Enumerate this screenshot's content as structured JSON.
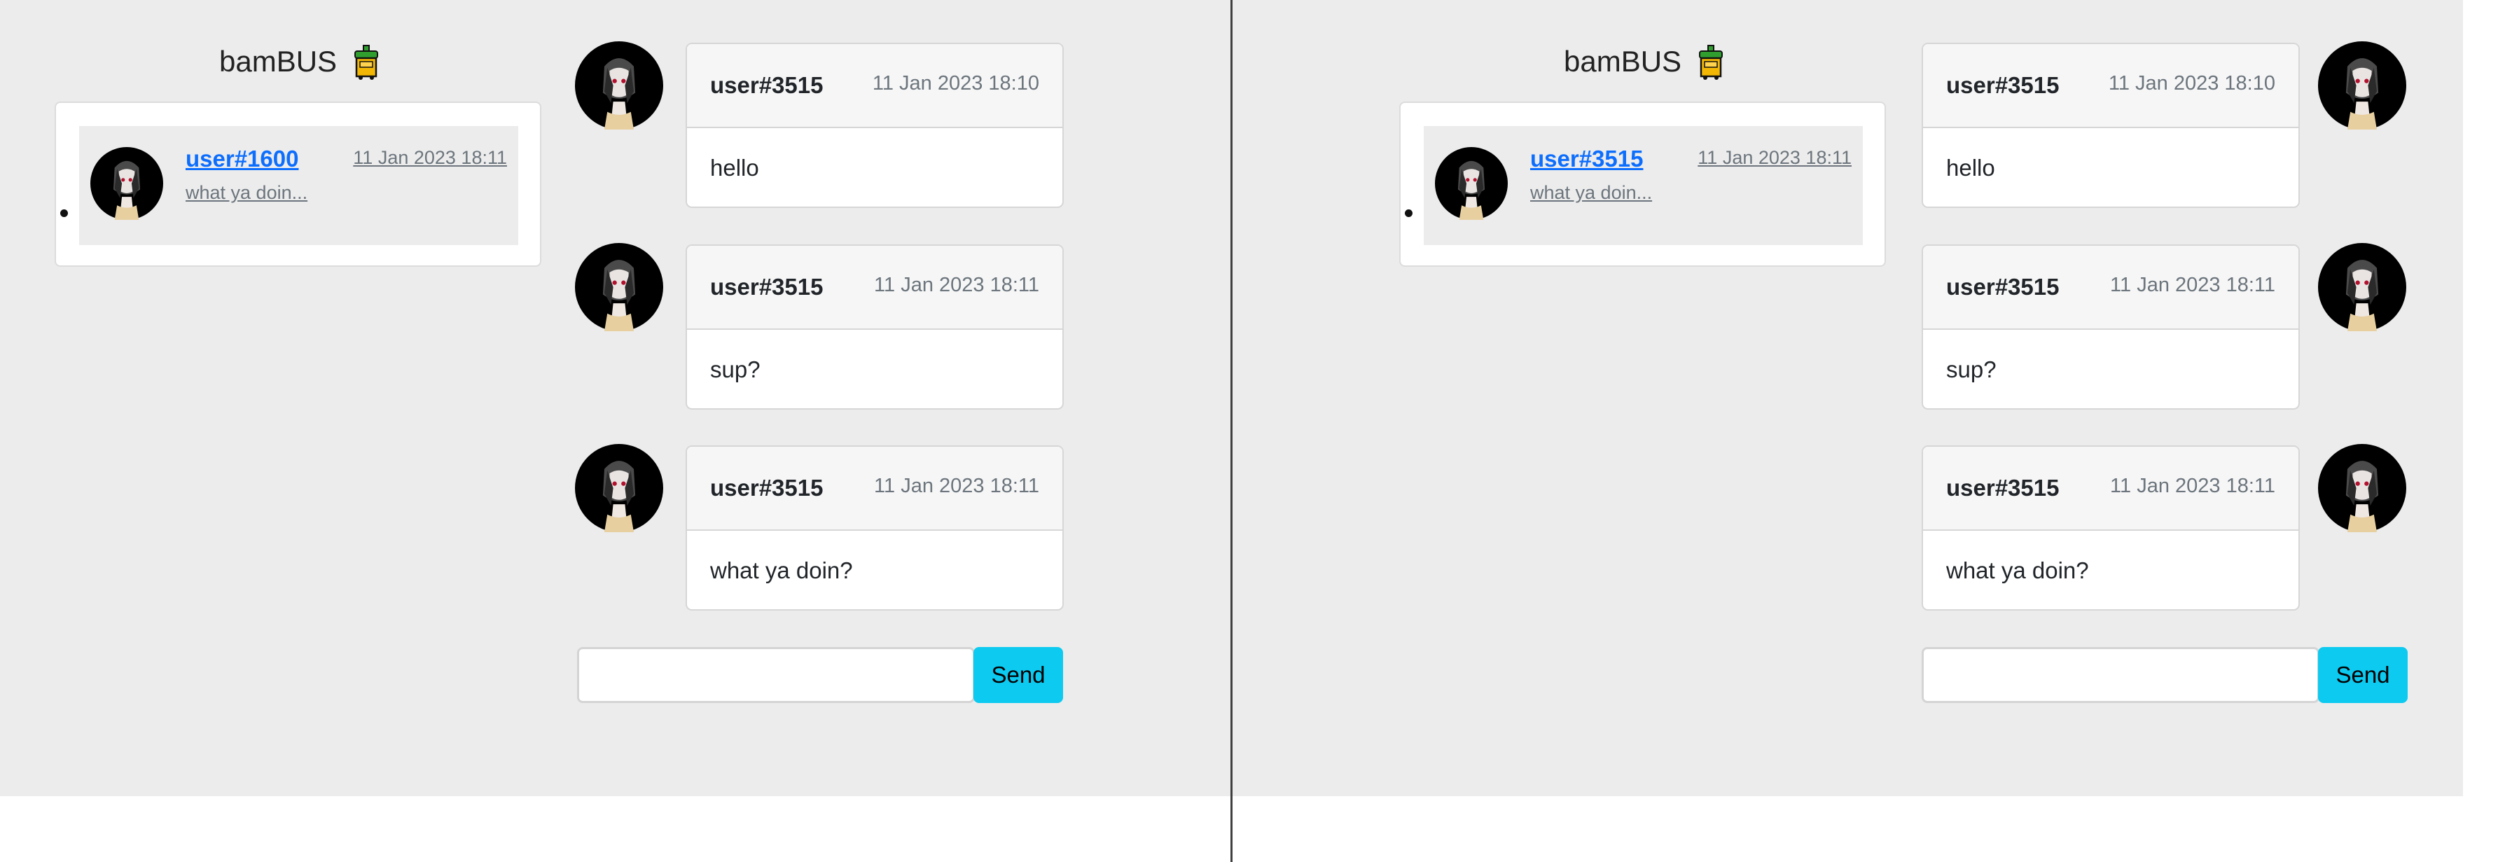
{
  "colors": {
    "page_background": "#ececec",
    "send_button": "#0dcaf0",
    "link": "#0d6efd",
    "muted_text": "#6c757d",
    "divider": "#3f3f3f"
  },
  "brand": {
    "title": "bamBUS",
    "icon": "bus-icon"
  },
  "panes": [
    {
      "chat_list": [
        {
          "username": "user#1600",
          "timestamp": "11 Jan 2023 18:11",
          "preview": "what ya doin..."
        }
      ],
      "messages": [
        {
          "username": "user#3515",
          "timestamp": "11 Jan 2023 18:10",
          "text": "hello"
        },
        {
          "username": "user#3515",
          "timestamp": "11 Jan 2023 18:11",
          "text": "sup?"
        },
        {
          "username": "user#3515",
          "timestamp": "11 Jan 2023 18:11",
          "text": "what ya doin?"
        }
      ],
      "input": {
        "value": "",
        "placeholder": ""
      },
      "send_label": "Send"
    },
    {
      "chat_list": [
        {
          "username": "user#3515",
          "timestamp": "11 Jan 2023 18:11",
          "preview": "what ya doin..."
        }
      ],
      "messages": [
        {
          "username": "user#3515",
          "timestamp": "11 Jan 2023 18:10",
          "text": "hello"
        },
        {
          "username": "user#3515",
          "timestamp": "11 Jan 2023 18:11",
          "text": "sup?"
        },
        {
          "username": "user#3515",
          "timestamp": "11 Jan 2023 18:11",
          "text": "what ya doin?"
        }
      ],
      "input": {
        "value": "",
        "placeholder": ""
      },
      "send_label": "Send"
    }
  ]
}
